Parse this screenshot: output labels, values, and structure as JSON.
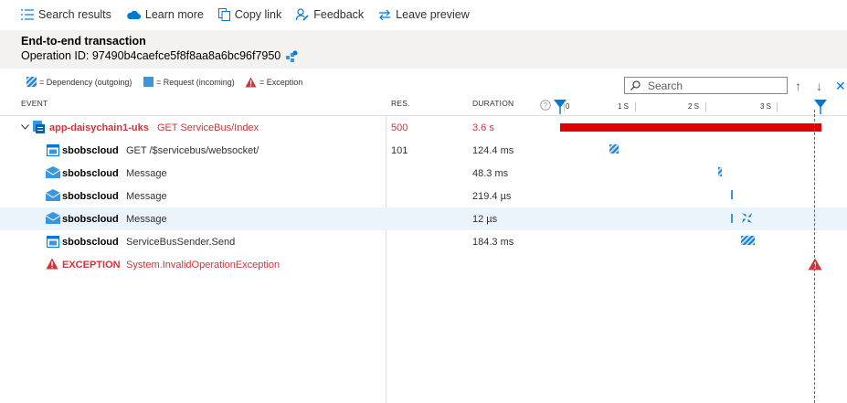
{
  "toolbar": {
    "search_results": "Search results",
    "learn_more": "Learn more",
    "copy_link": "Copy link",
    "feedback": "Feedback",
    "leave_preview": "Leave preview"
  },
  "header": {
    "title": "End-to-end transaction",
    "operation_id": "Operation ID: 97490b4caefce5f8f8aa8a6bc96f7950"
  },
  "legend": {
    "dependency": "= Dependency (outgoing)",
    "request": "= Request (incoming)",
    "exception": "= Exception"
  },
  "search": {
    "placeholder": "Search"
  },
  "columns": {
    "event": "EVENT",
    "res": "RES.",
    "duration": "DURATION"
  },
  "timeline": {
    "ticks": [
      "0",
      "1 S",
      "2 S",
      "3 S"
    ]
  },
  "rows": [
    {
      "name": "app-daisychain1-uks",
      "detail": "GET ServiceBus/Index",
      "res": "500",
      "duration": "3.6 s"
    },
    {
      "name": "sbobscloud",
      "detail": "GET /$servicebus/websocket/",
      "res": "101",
      "duration": "124.4 ms"
    },
    {
      "name": "sbobscloud",
      "detail": "Message",
      "res": "",
      "duration": "48.3 ms"
    },
    {
      "name": "sbobscloud",
      "detail": "Message",
      "res": "",
      "duration": "219.4 µs"
    },
    {
      "name": "sbobscloud",
      "detail": "Message",
      "res": "",
      "duration": "12 µs"
    },
    {
      "name": "sbobscloud",
      "detail": "ServiceBusSender.Send",
      "res": "",
      "duration": "184.3 ms"
    },
    {
      "name": "EXCEPTION",
      "detail": "System.InvalidOperationException",
      "res": "",
      "duration": ""
    }
  ],
  "colors": {
    "error": "#d13438",
    "accent": "#0078d4",
    "bar": "#e00000"
  }
}
